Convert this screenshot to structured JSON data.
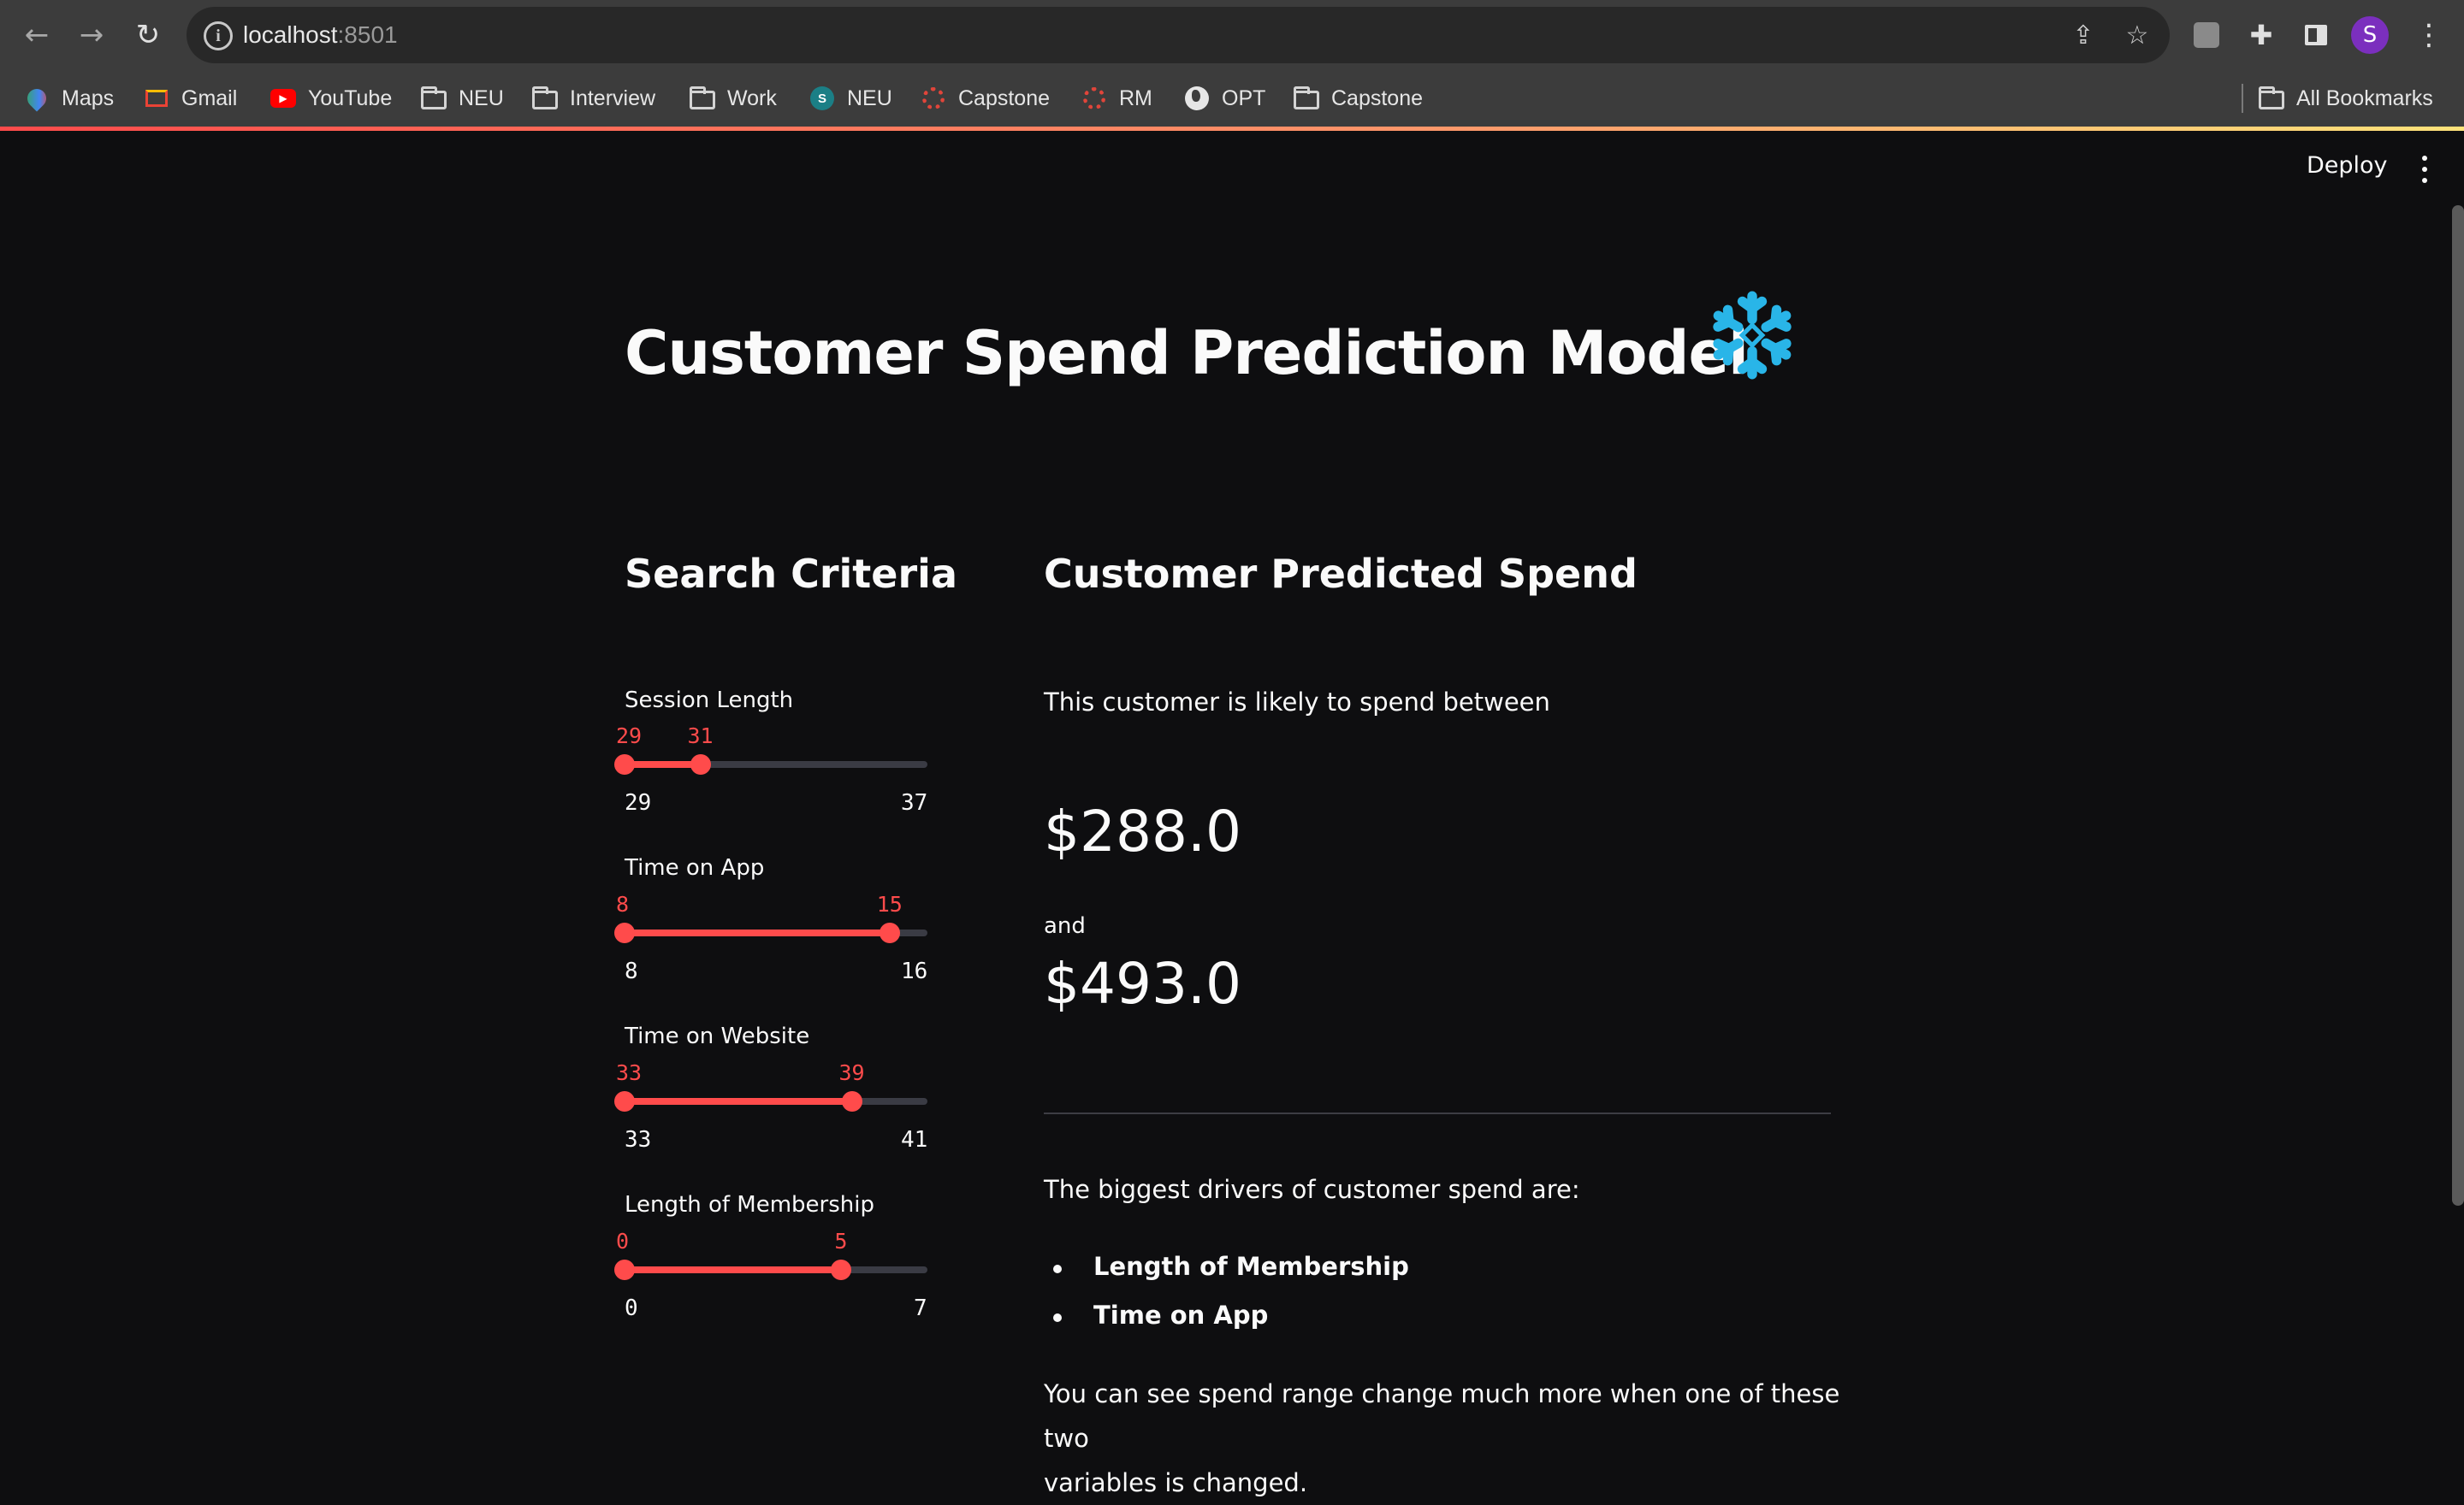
{
  "browser": {
    "url_host": "localhost",
    "url_port": ":8501",
    "profile_initial": "S",
    "bookmarks": [
      {
        "label": "Maps",
        "icon": "maps-icon"
      },
      {
        "label": "Gmail",
        "icon": "gmail-icon"
      },
      {
        "label": "YouTube",
        "icon": "youtube-icon"
      },
      {
        "label": "NEU",
        "icon": "folder-icon"
      },
      {
        "label": "Interview",
        "icon": "folder-icon"
      },
      {
        "label": "Work",
        "icon": "folder-icon"
      },
      {
        "label": "NEU",
        "icon": "sharepoint-icon"
      },
      {
        "label": "Capstone",
        "icon": "wheel-icon"
      },
      {
        "label": "RM",
        "icon": "wheel-icon"
      },
      {
        "label": "OPT",
        "icon": "globe-icon"
      },
      {
        "label": "Capstone",
        "icon": "folder-icon"
      }
    ],
    "all_bookmarks": "All Bookmarks"
  },
  "app": {
    "deploy_label": "Deploy",
    "title": "Customer Spend Prediction Model",
    "search_header": "Search Criteria",
    "result_header": "Customer Predicted Spend",
    "sliders": [
      {
        "label": "Session Length",
        "min": 29,
        "max": 37,
        "low": 29,
        "high": 31
      },
      {
        "label": "Time on App",
        "min": 8,
        "max": 16,
        "low": 8,
        "high": 15
      },
      {
        "label": "Time on Website",
        "min": 33,
        "max": 41,
        "low": 33,
        "high": 39
      },
      {
        "label": "Length of Membership",
        "min": 0,
        "max": 7,
        "low": 0,
        "high": 5
      }
    ],
    "likely_text": "This customer is likely to spend between",
    "low_spend": "$288.0",
    "and_text": "and",
    "high_spend": "$493.0",
    "drivers_text": "The biggest drivers of customer spend are:",
    "drivers": [
      "Length of Membership",
      "Time on App"
    ],
    "footer_line1": "You can see spend range change much more when one of these two",
    "footer_line2": "variables is changed."
  },
  "colors": {
    "accent": "#ff4b4b",
    "background": "#0e0e10",
    "snowflake": "#29b5e8"
  }
}
